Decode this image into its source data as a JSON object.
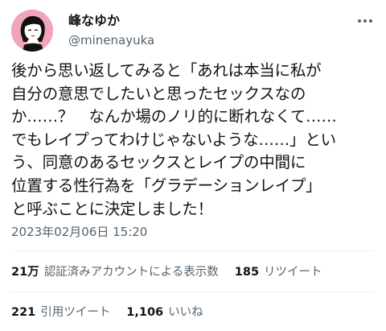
{
  "author": {
    "display_name": "峰なゆか",
    "handle": "@minenayuka"
  },
  "tweet": {
    "lines": [
      "後から思い返してみると「あれは本当に私が",
      "自分の意思でしたいと思ったセックスなの",
      "か……？　なんか場のノリ的に断れなくて……",
      "でもレイプってわけじゃないような……」とい",
      "う、同意のあるセックスとレイプの中間に",
      "位置する性行為を「グラデーションレイプ」",
      "と呼ぶことに決定しました！"
    ],
    "timestamp": "2023年02月06日 15:20"
  },
  "stats": {
    "views_count": "21万",
    "views_label": "認証済みアカウントによる表示数",
    "retweets_count": "185",
    "retweets_label": "リツイート",
    "quotes_count": "221",
    "quotes_label": "引用ツイート",
    "likes_count": "1,106",
    "likes_label": "いいね"
  },
  "icons": {
    "more": "more-horizontal-icon",
    "avatar": "avatar-illustration"
  },
  "colors": {
    "text": "#0f1419",
    "secondary": "#536471",
    "divider": "#eff3f4",
    "avatar_bg": "#f2a5b8"
  }
}
